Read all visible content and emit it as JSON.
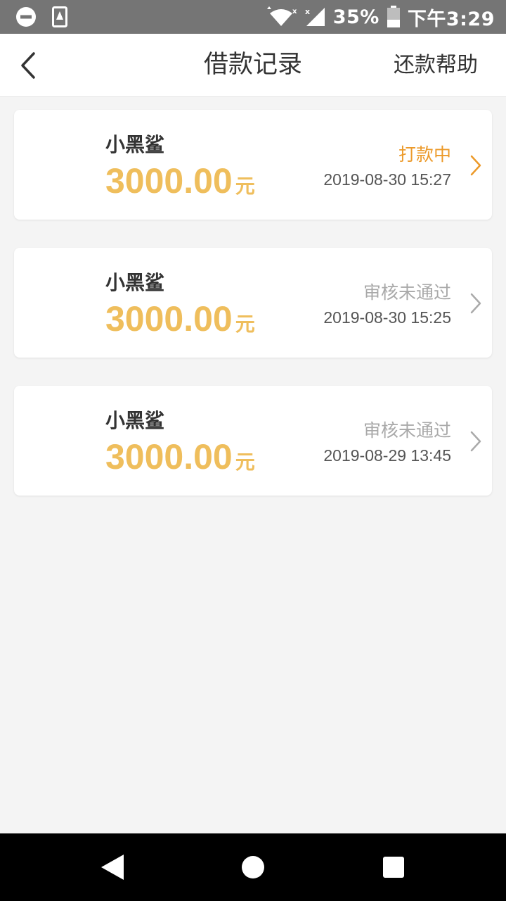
{
  "status_bar": {
    "battery_percent": "35%",
    "time": "下午3:29",
    "icons": [
      "dnd-icon",
      "sim-icon",
      "wifi-icon",
      "signal-icon",
      "battery-icon"
    ]
  },
  "header": {
    "title": "借款记录",
    "help_label": "还款帮助",
    "back_icon": "back-arrow-icon"
  },
  "records": [
    {
      "lender": "小黑鲨",
      "amount": "3000.00",
      "unit": "元",
      "status": "打款中",
      "status_color": "#ec9a2a",
      "chevron_color": "#ec9a2a",
      "datetime": "2019-08-30 15:27"
    },
    {
      "lender": "小黑鲨",
      "amount": "3000.00",
      "unit": "元",
      "status": "审核未通过",
      "status_color": "#a9a9a9",
      "chevron_color": "#aaaaaa",
      "datetime": "2019-08-30 15:25"
    },
    {
      "lender": "小黑鲨",
      "amount": "3000.00",
      "unit": "元",
      "status": "审核未通过",
      "status_color": "#a9a9a9",
      "chevron_color": "#aaaaaa",
      "datetime": "2019-08-29 13:45"
    }
  ],
  "colors": {
    "amount": "#efbe5c",
    "background": "#f4f4f4",
    "status_bar": "#757575"
  },
  "nav_bar": {
    "icons": [
      "back-triangle-icon",
      "home-circle-icon",
      "recents-square-icon"
    ]
  }
}
